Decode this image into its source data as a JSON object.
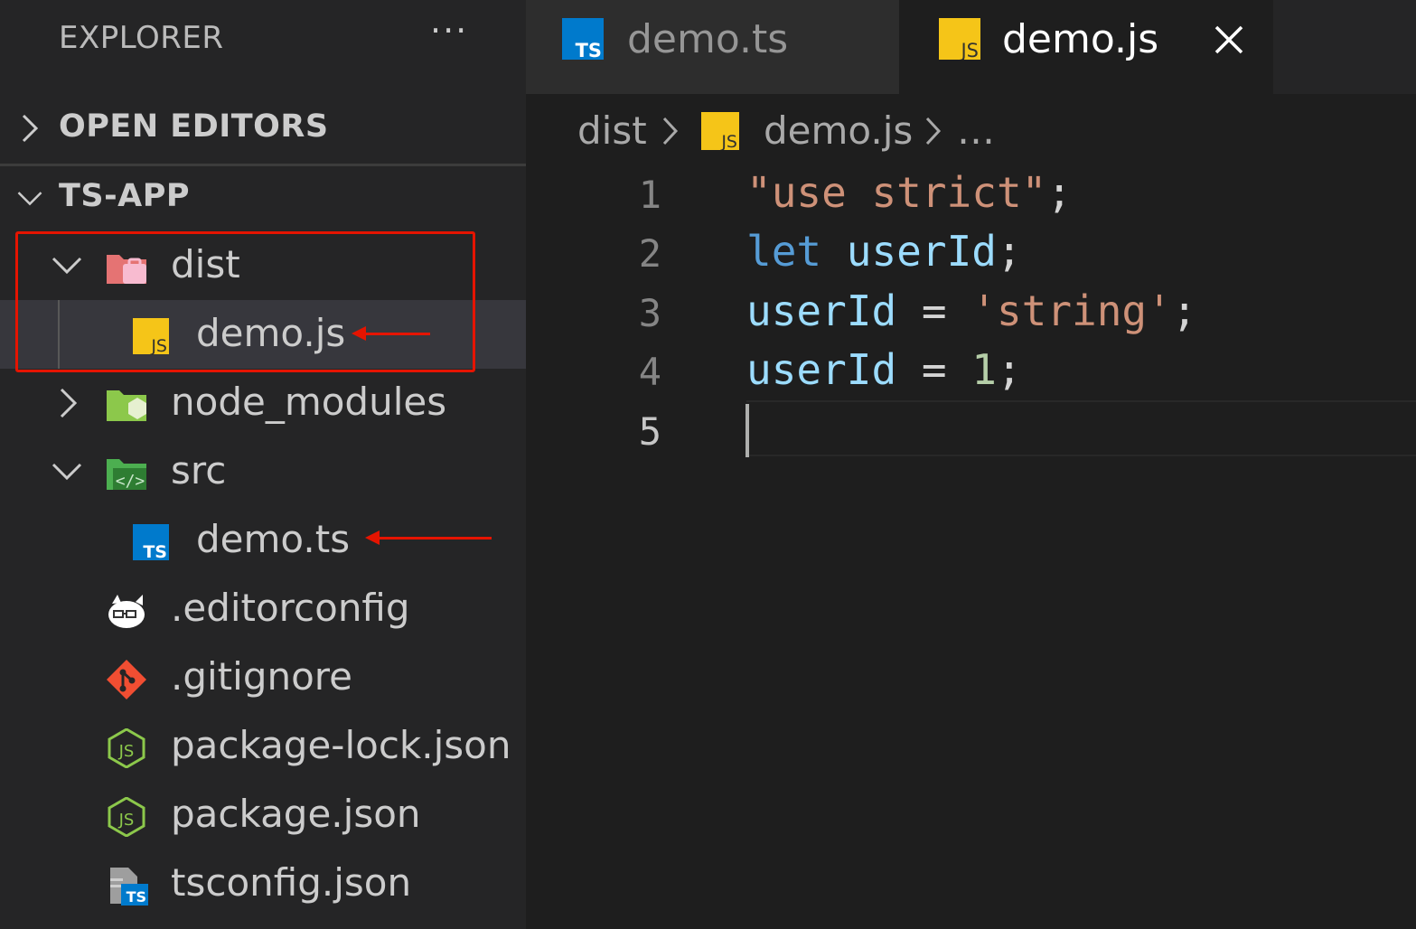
{
  "colors": {
    "annotation_red": "#e51400",
    "ts_blue": "#007acc",
    "js_yellow": "#f5c518",
    "node_green": "#8cc84b",
    "git_orange": "#f14e32"
  },
  "sidebar": {
    "title": "EXPLORER",
    "more_icon": "ellipsis-icon",
    "more_label": "···",
    "sections": {
      "open_editors": {
        "label": "OPEN EDITORS",
        "expanded": false
      },
      "project": {
        "label": "TS-APP",
        "expanded": true
      }
    },
    "tree": {
      "dist": {
        "label": "dist",
        "icon": "folder-dist-icon",
        "expanded": true
      },
      "dist_demo_js": {
        "label": "demo.js",
        "icon": "javascript-file-icon",
        "selected": true
      },
      "node_modules": {
        "label": "node_modules",
        "icon": "folder-node-icon",
        "expanded": false
      },
      "src": {
        "label": "src",
        "icon": "folder-src-icon",
        "expanded": true
      },
      "src_demo_ts": {
        "label": "demo.ts",
        "icon": "typescript-file-icon"
      },
      "editorconfig": {
        "label": ".editorconfig",
        "icon": "editorconfig-icon"
      },
      "gitignore": {
        "label": ".gitignore",
        "icon": "git-icon"
      },
      "package_lock": {
        "label": "package-lock.json",
        "icon": "nodejs-icon"
      },
      "package": {
        "label": "package.json",
        "icon": "nodejs-icon"
      },
      "tsconfig": {
        "label": "tsconfig.json",
        "icon": "tsconfig-icon"
      }
    }
  },
  "tabs": [
    {
      "label": "demo.ts",
      "icon": "typescript-file-icon",
      "active": false
    },
    {
      "label": "demo.js",
      "icon": "javascript-file-icon",
      "active": true,
      "close_icon": "close-icon"
    }
  ],
  "breadcrumb": {
    "folder": "dist",
    "file": "demo.js",
    "more": "…"
  },
  "editor": {
    "active_line": 5,
    "line_numbers": [
      "1",
      "2",
      "3",
      "4",
      "5"
    ],
    "lines": [
      {
        "t1": "\"use strict\"",
        "t2": ";"
      },
      {
        "t1": "let",
        "t2": " ",
        "t3": "userId",
        "t4": ";"
      },
      {
        "t1": "userId",
        "t2": " = ",
        "t3": "'string'",
        "t4": ";"
      },
      {
        "t1": "userId",
        "t2": " = ",
        "t3": "1",
        "t4": ";"
      },
      {
        "t1": ""
      }
    ]
  }
}
